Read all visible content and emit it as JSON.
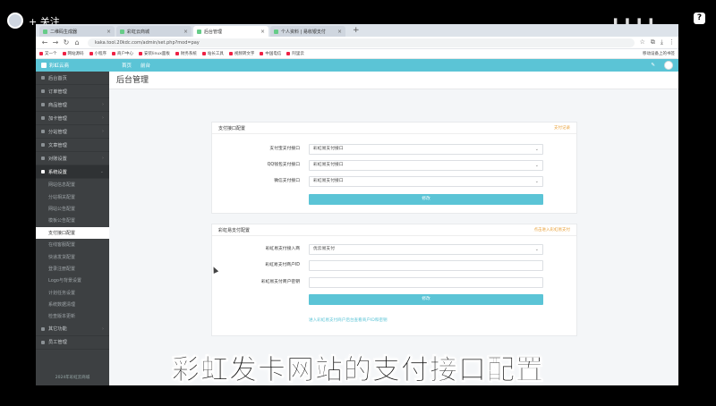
{
  "overlay": {
    "follow_label": "+ 关注",
    "help_glyph": "?"
  },
  "browser": {
    "tabs": [
      {
        "label": "二维码生成器",
        "active": false
      },
      {
        "label": "彩虹云商城",
        "active": false
      },
      {
        "label": "后台管理",
        "active": true
      },
      {
        "label": "个人资料 | 易收银支付",
        "active": false
      }
    ],
    "new_tab": "+",
    "url": "kaka.tool.20kdc.com/admin/set.php?mod=pay",
    "bookmarks": [
      "又一个",
      "网站源码",
      "小程序",
      "商户中心",
      "安装linux面板",
      "财务系统",
      "站长工具",
      "视频转文字",
      "中国电信",
      "阿里云"
    ],
    "bookmark_right": "移动设备上的书签"
  },
  "app": {
    "brand": "彩虹云商",
    "nav_links": [
      "首页",
      "前台"
    ],
    "page_title": "后台管理"
  },
  "sidebar": {
    "items": [
      {
        "label": "后台首页"
      },
      {
        "label": "订单管理"
      },
      {
        "label": "商品管理"
      },
      {
        "label": "加卡管理"
      },
      {
        "label": "分站管理"
      },
      {
        "label": "文章管理"
      },
      {
        "label": "对账设置"
      }
    ],
    "open_item": "系统设置",
    "subitems": [
      {
        "label": "网站信息配置",
        "active": false
      },
      {
        "label": "分站相关配置",
        "active": false
      },
      {
        "label": "网站公告配置",
        "active": false
      },
      {
        "label": "模板公告配置",
        "active": false
      },
      {
        "label": "支付接口配置",
        "active": true
      },
      {
        "label": "在线客服配置",
        "active": false
      },
      {
        "label": "快递发货配置",
        "active": false
      },
      {
        "label": "登录注册配置",
        "active": false
      },
      {
        "label": "Logo与背景设置",
        "active": false
      },
      {
        "label": "计划任务设置",
        "active": false
      },
      {
        "label": "系统数据清理",
        "active": false
      },
      {
        "label": "检查版本更新",
        "active": false
      }
    ],
    "tail_items": [
      {
        "label": "其它功能"
      },
      {
        "label": "员工管理"
      }
    ],
    "footer": "2024年彩虹云商城"
  },
  "pay_panel": {
    "title": "支付接口配置",
    "link": "支付记录",
    "rows": [
      {
        "label": "支付宝支付接口",
        "value": "彩虹易支付接口"
      },
      {
        "label": "QQ钱包支付接口",
        "value": "彩虹易支付接口"
      },
      {
        "label": "微信支付接口",
        "value": "彩虹易支付接口"
      }
    ],
    "save": "修改"
  },
  "epay_panel": {
    "title": "彩虹易支付配置",
    "link": "点击进入彩虹易支付",
    "rows": [
      {
        "label": "彩虹易支付接入商",
        "value": "优云易支付"
      },
      {
        "label": "彩虹易支付商户ID",
        "value": ""
      },
      {
        "label": "彩虹易支付商户密钥",
        "value": ""
      }
    ],
    "save": "修改",
    "note": "进入彩虹易支付商户后台查看商户ID和密钥"
  },
  "subtitle": "彩虹发卡网站的支付接口配置"
}
